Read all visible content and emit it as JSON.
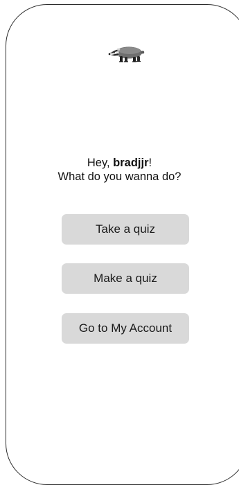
{
  "header": {
    "logo_icon": "badger-icon"
  },
  "greeting": {
    "prefix": "Hey, ",
    "username": "bradjjr",
    "suffix": "!",
    "question": "What do you wanna do?"
  },
  "actions": {
    "take_quiz_label": "Take a quiz",
    "make_quiz_label": "Make a quiz",
    "account_label": "Go to My Account"
  },
  "colors": {
    "button_bg": "#d9d9d9",
    "frame_border": "#2b2b2b"
  }
}
